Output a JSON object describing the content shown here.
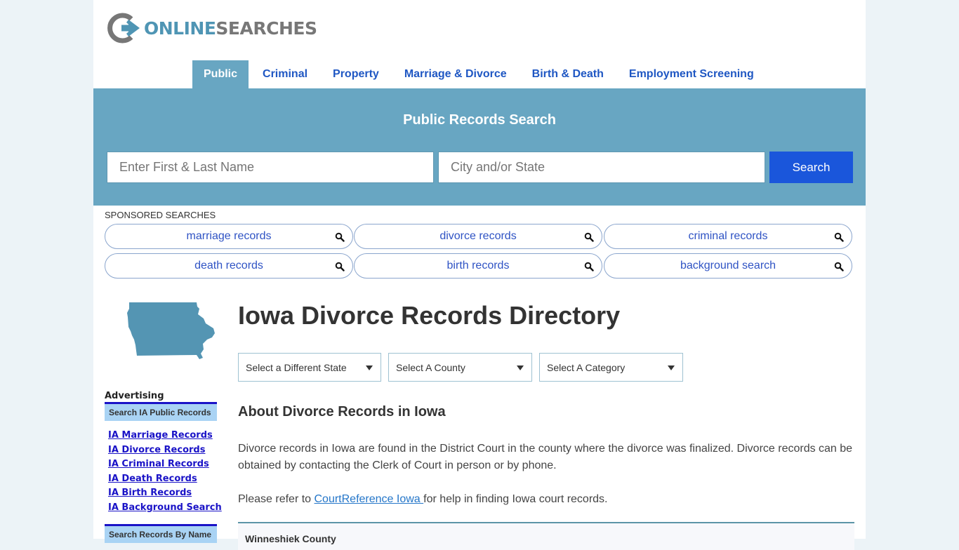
{
  "brand": {
    "logo_part1": "ONLINE",
    "logo_part2": "SEARCHES",
    "logo_icon": "circle-arrow-logo-icon",
    "colors": {
      "primary": "#68a6c2",
      "nav_link": "#1f57c3",
      "search_button": "#1a56db",
      "logo_blue": "#4f95b4",
      "logo_gray": "#777777"
    }
  },
  "nav": {
    "items": [
      {
        "label": "Public",
        "active": true
      },
      {
        "label": "Criminal",
        "active": false
      },
      {
        "label": "Property",
        "active": false
      },
      {
        "label": "Marriage & Divorce",
        "active": false
      },
      {
        "label": "Birth & Death",
        "active": false
      },
      {
        "label": "Employment Screening",
        "active": false
      }
    ]
  },
  "search": {
    "title": "Public Records Search",
    "name_placeholder": "Enter First & Last Name",
    "name_value": "",
    "location_placeholder": "City and/or State",
    "location_value": "",
    "button_label": "Search"
  },
  "sponsored": {
    "label": "SPONSORED SEARCHES",
    "icon": "search-icon",
    "items": [
      {
        "label": "marriage records"
      },
      {
        "label": "divorce records"
      },
      {
        "label": "criminal records"
      },
      {
        "label": "death records"
      },
      {
        "label": "birth records"
      },
      {
        "label": "background search"
      }
    ]
  },
  "sidebar": {
    "map_icon": "iowa-state-map",
    "advertising_label": "Advertising",
    "box1_header": "Search IA Public Records",
    "links": [
      {
        "label": "IA Marriage Records"
      },
      {
        "label": "IA Divorce Records"
      },
      {
        "label": "IA Criminal Records"
      },
      {
        "label": "IA Death Records"
      },
      {
        "label": "IA Birth Records"
      },
      {
        "label": "IA Background Search"
      }
    ],
    "box2_header": "Search Records By Name"
  },
  "main": {
    "title": "Iowa Divorce Records Directory",
    "selects": [
      {
        "label": "Select a Different State"
      },
      {
        "label": "Select A County"
      },
      {
        "label": "Select A Category"
      }
    ],
    "about_heading": "About Divorce Records in Iowa",
    "paragraph1": "Divorce records in Iowa are found in the District Court in the county where the divorce was finalized. Divorce records can be obtained by contacting the Clerk of Court in person or by phone.",
    "paragraph2_prefix": "Please refer to ",
    "paragraph2_link": "CourtReference Iowa ",
    "paragraph2_suffix": "for help in finding Iowa court records.",
    "first_county": "Winneshiek County"
  }
}
